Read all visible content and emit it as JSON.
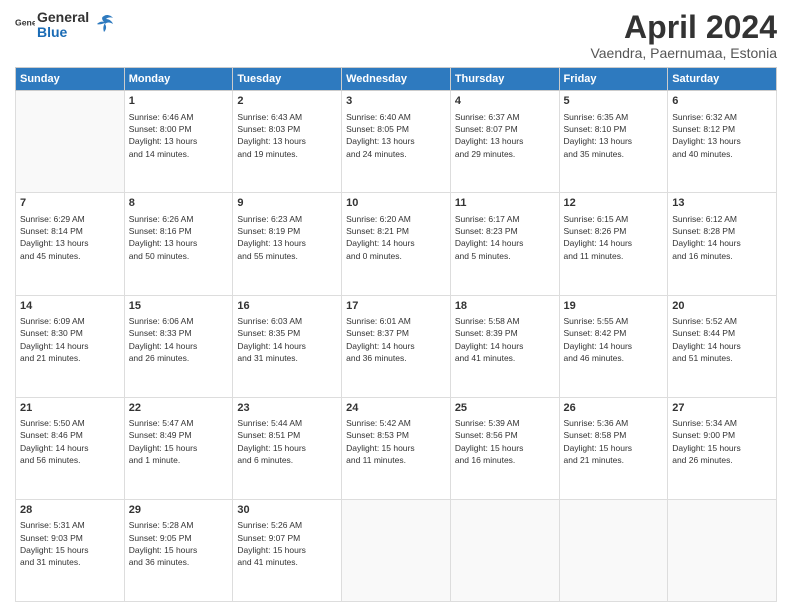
{
  "header": {
    "logo_general": "General",
    "logo_blue": "Blue",
    "title": "April 2024",
    "subtitle": "Vaendra, Paernumaa, Estonia"
  },
  "calendar": {
    "weekdays": [
      "Sunday",
      "Monday",
      "Tuesday",
      "Wednesday",
      "Thursday",
      "Friday",
      "Saturday"
    ],
    "weeks": [
      [
        {
          "day": "",
          "info": ""
        },
        {
          "day": "1",
          "info": "Sunrise: 6:46 AM\nSunset: 8:00 PM\nDaylight: 13 hours\nand 14 minutes."
        },
        {
          "day": "2",
          "info": "Sunrise: 6:43 AM\nSunset: 8:03 PM\nDaylight: 13 hours\nand 19 minutes."
        },
        {
          "day": "3",
          "info": "Sunrise: 6:40 AM\nSunset: 8:05 PM\nDaylight: 13 hours\nand 24 minutes."
        },
        {
          "day": "4",
          "info": "Sunrise: 6:37 AM\nSunset: 8:07 PM\nDaylight: 13 hours\nand 29 minutes."
        },
        {
          "day": "5",
          "info": "Sunrise: 6:35 AM\nSunset: 8:10 PM\nDaylight: 13 hours\nand 35 minutes."
        },
        {
          "day": "6",
          "info": "Sunrise: 6:32 AM\nSunset: 8:12 PM\nDaylight: 13 hours\nand 40 minutes."
        }
      ],
      [
        {
          "day": "7",
          "info": "Sunrise: 6:29 AM\nSunset: 8:14 PM\nDaylight: 13 hours\nand 45 minutes."
        },
        {
          "day": "8",
          "info": "Sunrise: 6:26 AM\nSunset: 8:16 PM\nDaylight: 13 hours\nand 50 minutes."
        },
        {
          "day": "9",
          "info": "Sunrise: 6:23 AM\nSunset: 8:19 PM\nDaylight: 13 hours\nand 55 minutes."
        },
        {
          "day": "10",
          "info": "Sunrise: 6:20 AM\nSunset: 8:21 PM\nDaylight: 14 hours\nand 0 minutes."
        },
        {
          "day": "11",
          "info": "Sunrise: 6:17 AM\nSunset: 8:23 PM\nDaylight: 14 hours\nand 5 minutes."
        },
        {
          "day": "12",
          "info": "Sunrise: 6:15 AM\nSunset: 8:26 PM\nDaylight: 14 hours\nand 11 minutes."
        },
        {
          "day": "13",
          "info": "Sunrise: 6:12 AM\nSunset: 8:28 PM\nDaylight: 14 hours\nand 16 minutes."
        }
      ],
      [
        {
          "day": "14",
          "info": "Sunrise: 6:09 AM\nSunset: 8:30 PM\nDaylight: 14 hours\nand 21 minutes."
        },
        {
          "day": "15",
          "info": "Sunrise: 6:06 AM\nSunset: 8:33 PM\nDaylight: 14 hours\nand 26 minutes."
        },
        {
          "day": "16",
          "info": "Sunrise: 6:03 AM\nSunset: 8:35 PM\nDaylight: 14 hours\nand 31 minutes."
        },
        {
          "day": "17",
          "info": "Sunrise: 6:01 AM\nSunset: 8:37 PM\nDaylight: 14 hours\nand 36 minutes."
        },
        {
          "day": "18",
          "info": "Sunrise: 5:58 AM\nSunset: 8:39 PM\nDaylight: 14 hours\nand 41 minutes."
        },
        {
          "day": "19",
          "info": "Sunrise: 5:55 AM\nSunset: 8:42 PM\nDaylight: 14 hours\nand 46 minutes."
        },
        {
          "day": "20",
          "info": "Sunrise: 5:52 AM\nSunset: 8:44 PM\nDaylight: 14 hours\nand 51 minutes."
        }
      ],
      [
        {
          "day": "21",
          "info": "Sunrise: 5:50 AM\nSunset: 8:46 PM\nDaylight: 14 hours\nand 56 minutes."
        },
        {
          "day": "22",
          "info": "Sunrise: 5:47 AM\nSunset: 8:49 PM\nDaylight: 15 hours\nand 1 minute."
        },
        {
          "day": "23",
          "info": "Sunrise: 5:44 AM\nSunset: 8:51 PM\nDaylight: 15 hours\nand 6 minutes."
        },
        {
          "day": "24",
          "info": "Sunrise: 5:42 AM\nSunset: 8:53 PM\nDaylight: 15 hours\nand 11 minutes."
        },
        {
          "day": "25",
          "info": "Sunrise: 5:39 AM\nSunset: 8:56 PM\nDaylight: 15 hours\nand 16 minutes."
        },
        {
          "day": "26",
          "info": "Sunrise: 5:36 AM\nSunset: 8:58 PM\nDaylight: 15 hours\nand 21 minutes."
        },
        {
          "day": "27",
          "info": "Sunrise: 5:34 AM\nSunset: 9:00 PM\nDaylight: 15 hours\nand 26 minutes."
        }
      ],
      [
        {
          "day": "28",
          "info": "Sunrise: 5:31 AM\nSunset: 9:03 PM\nDaylight: 15 hours\nand 31 minutes."
        },
        {
          "day": "29",
          "info": "Sunrise: 5:28 AM\nSunset: 9:05 PM\nDaylight: 15 hours\nand 36 minutes."
        },
        {
          "day": "30",
          "info": "Sunrise: 5:26 AM\nSunset: 9:07 PM\nDaylight: 15 hours\nand 41 minutes."
        },
        {
          "day": "",
          "info": ""
        },
        {
          "day": "",
          "info": ""
        },
        {
          "day": "",
          "info": ""
        },
        {
          "day": "",
          "info": ""
        }
      ]
    ]
  }
}
